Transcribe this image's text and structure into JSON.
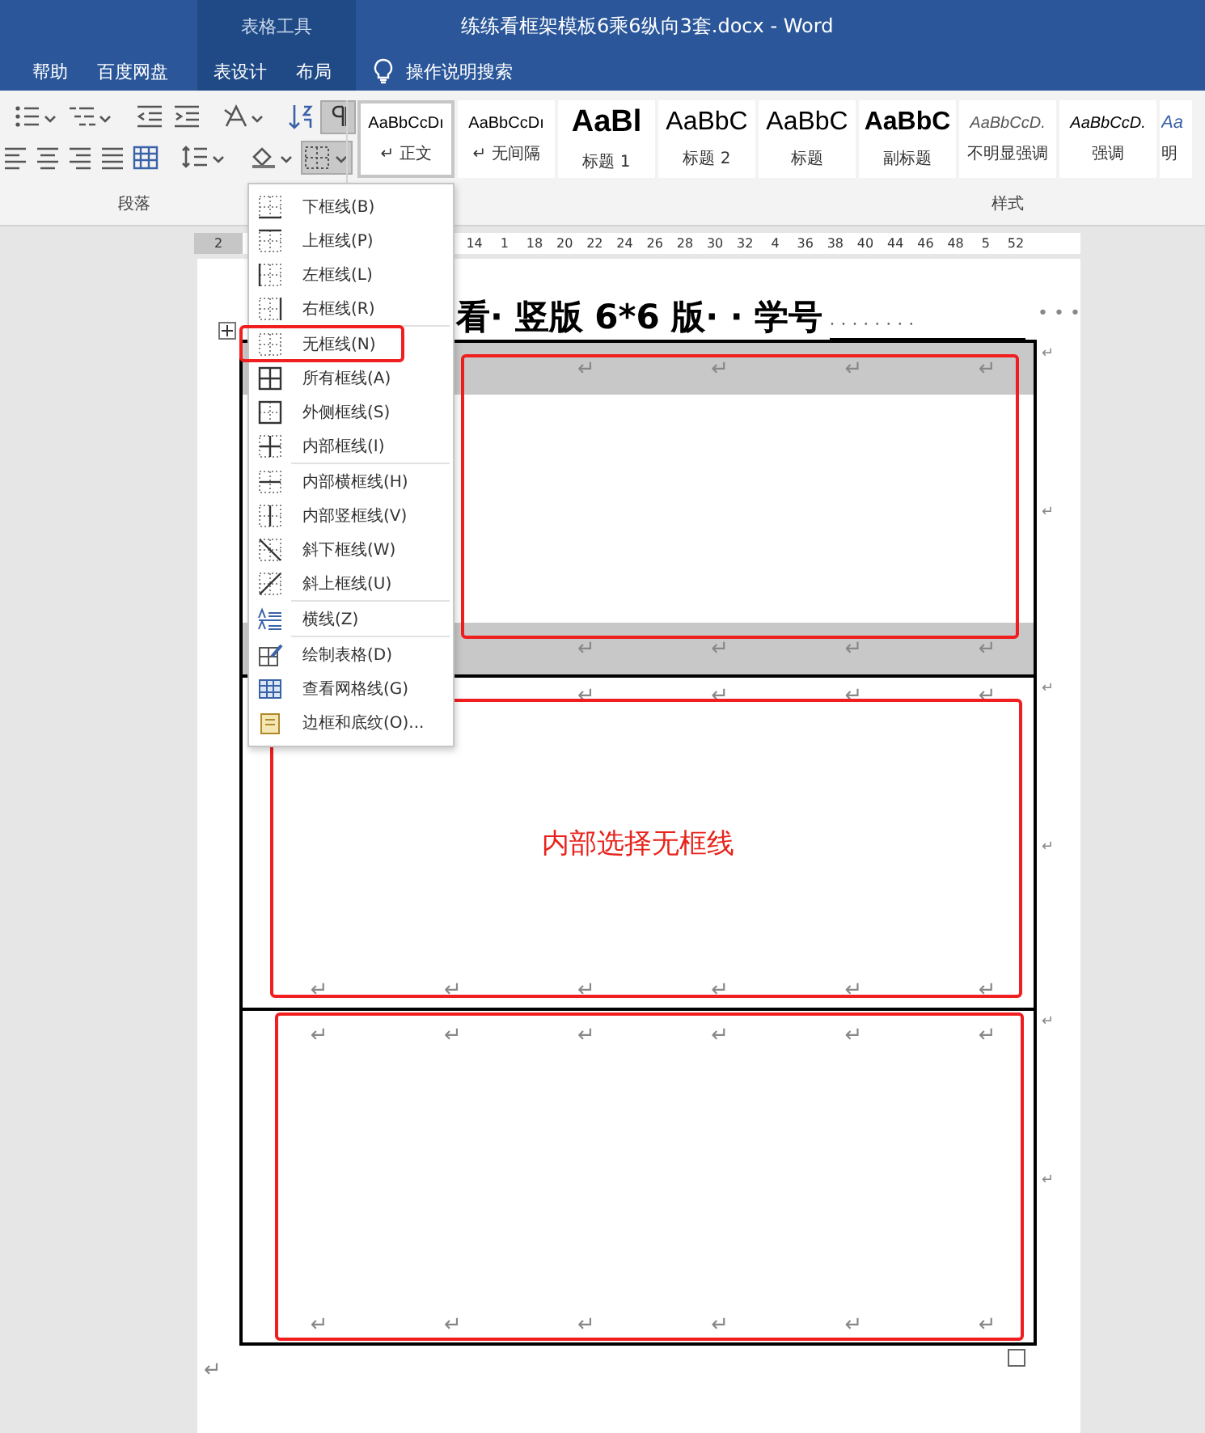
{
  "window": {
    "title": "练练看框架模板6乘6纵向3套.docx  -  Word",
    "context_label": "表格工具"
  },
  "tabs": [
    {
      "label": "帮助",
      "selected": false,
      "context": false
    },
    {
      "label": "百度网盘",
      "selected": false,
      "context": false
    },
    {
      "label": "表设计",
      "selected": false,
      "context": true
    },
    {
      "label": "布局",
      "selected": false,
      "context": true
    }
  ],
  "search": {
    "label": "操作说明搜索"
  },
  "paragraph_group": {
    "label": "段落",
    "show_formatting_marks": true,
    "borders_menu_open": true
  },
  "styles_group": {
    "label": "样式",
    "items": [
      {
        "preview": "AaBbCcDı",
        "name": "↵ 正文",
        "kind": "normal",
        "selected": true
      },
      {
        "preview": "AaBbCcDı",
        "name": "↵ 无间隔",
        "kind": "normal",
        "selected": false
      },
      {
        "preview": "AaBl",
        "name": "标题 1",
        "kind": "heading1",
        "selected": false
      },
      {
        "preview": "AaBbC",
        "name": "标题 2",
        "kind": "heading2",
        "selected": false
      },
      {
        "preview": "AaBbC",
        "name": "标题",
        "kind": "title",
        "selected": false
      },
      {
        "preview": "AaBbC",
        "name": "副标题",
        "kind": "subtitle",
        "selected": false
      },
      {
        "preview": "AaBbCcD.",
        "name": "不明显强调",
        "kind": "subtle",
        "selected": false
      },
      {
        "preview": "AaBbCcD.",
        "name": "强调",
        "kind": "emphasis",
        "selected": false
      },
      {
        "preview": "Aa",
        "name": "明",
        "kind": "strong",
        "selected": false
      }
    ]
  },
  "ruler": {
    "left_label": "2",
    "labels": [
      "14",
      "1",
      "18",
      "20",
      "22",
      "24",
      "26",
      "28",
      "30",
      "32",
      "4",
      "36",
      "38",
      "40",
      "44",
      "46",
      "48",
      "5",
      "52"
    ]
  },
  "document": {
    "heading": "看· 竖版 6*6 版· · 学号",
    "blank": "· · · · · · · ·",
    "trailing_marks": "•  •  •",
    "table_sections": [
      {
        "shaded": true,
        "highlighted": true,
        "top_marks": [
          "↵",
          "↵",
          "↵",
          "↵"
        ],
        "bottom_marks": [
          "↵",
          "↵",
          "↵",
          "↵"
        ],
        "side_marks": [
          "↵",
          "↵"
        ]
      },
      {
        "shaded": false,
        "highlighted": true,
        "note": "内部选择无框线",
        "top_marks": [
          "↵",
          "↵",
          "↵",
          "↵"
        ],
        "bottom_marks": [
          "↵",
          "↵",
          "↵",
          "↵",
          "↵",
          "↵"
        ],
        "side_marks": [
          "↵",
          "↵"
        ]
      },
      {
        "shaded": false,
        "highlighted": true,
        "top_marks": [
          "↵",
          "↵",
          "↵",
          "↵",
          "↵",
          "↵"
        ],
        "bottom_marks": [
          "↵",
          "↵",
          "↵",
          "↵",
          "↵",
          "↵"
        ],
        "side_marks": [
          "↵",
          "↵"
        ]
      }
    ],
    "end_mark": "↵"
  },
  "borders_menu": {
    "sections": [
      {
        "items": [
          {
            "label": "下框线(B)",
            "kind": "bottom",
            "highlighted": false
          },
          {
            "label": "上框线(P)",
            "kind": "top",
            "highlighted": false
          },
          {
            "label": "左框线(L)",
            "kind": "left",
            "highlighted": false
          },
          {
            "label": "右框线(R)",
            "kind": "right",
            "highlighted": false
          }
        ]
      },
      {
        "items": [
          {
            "label": "无框线(N)",
            "kind": "none",
            "highlighted": true
          },
          {
            "label": "所有框线(A)",
            "kind": "all",
            "highlighted": false
          },
          {
            "label": "外侧框线(S)",
            "kind": "outside",
            "highlighted": false
          },
          {
            "label": "内部框线(I)",
            "kind": "inside",
            "highlighted": false
          }
        ]
      },
      {
        "items": [
          {
            "label": "内部横框线(H)",
            "kind": "inside-h",
            "highlighted": false
          },
          {
            "label": "内部竖框线(V)",
            "kind": "inside-v",
            "highlighted": false
          },
          {
            "label": "斜下框线(W)",
            "kind": "diag-down",
            "highlighted": false
          },
          {
            "label": "斜上框线(U)",
            "kind": "diag-up",
            "highlighted": false
          }
        ]
      },
      {
        "items": [
          {
            "label": "横线(Z)",
            "kind": "hline",
            "highlighted": false
          }
        ]
      },
      {
        "items": [
          {
            "label": "绘制表格(D)",
            "kind": "draw",
            "highlighted": false
          },
          {
            "label": "查看网格线(G)",
            "kind": "grid",
            "highlighted": false
          },
          {
            "label": "边框和底纹(O)...",
            "kind": "dialog",
            "highlighted": false
          }
        ]
      }
    ]
  }
}
